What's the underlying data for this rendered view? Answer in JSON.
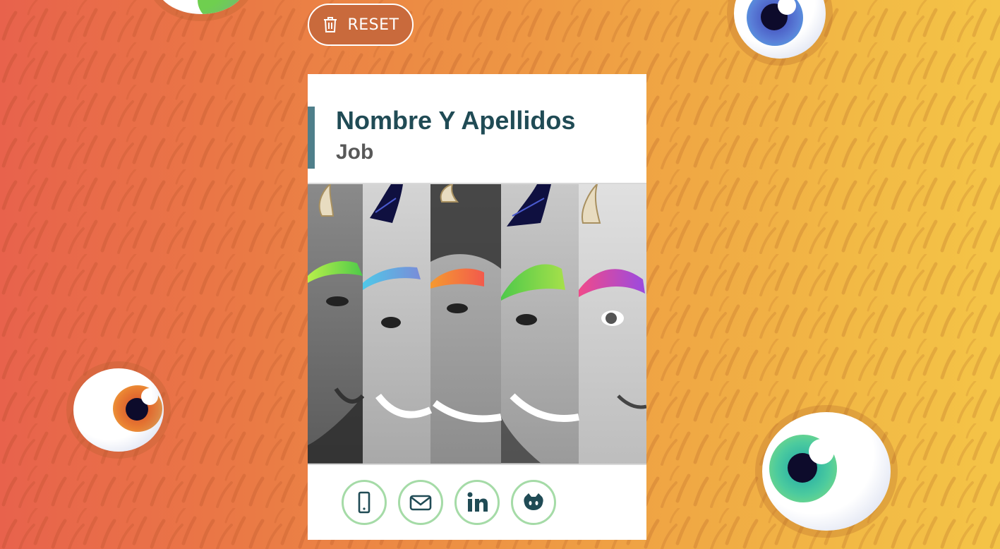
{
  "toolbar": {
    "reset_label": "RESET"
  },
  "card": {
    "name": "Nombre Y Apellidos",
    "job": "Job",
    "accent_color": "#4f7f8a",
    "photo_alt": "Collage of five smiling faces with horns and colorful hair"
  },
  "social_links": [
    {
      "name": "phone-icon"
    },
    {
      "name": "email-icon"
    },
    {
      "name": "linkedin-icon"
    },
    {
      "name": "github-icon"
    }
  ],
  "colors": {
    "background_start": "#e8624c",
    "background_end": "#f4c447",
    "social_border": "#a5dba7",
    "name_text": "#204b55"
  }
}
